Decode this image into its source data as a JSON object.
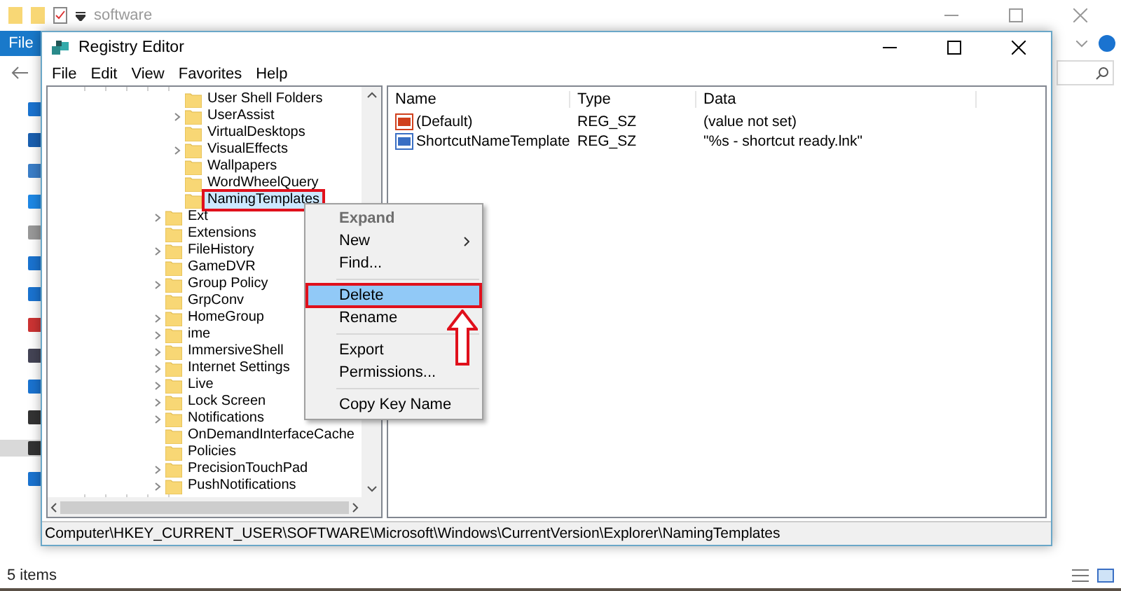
{
  "explorer": {
    "title": "software",
    "file_tab": "File",
    "status": "5 items"
  },
  "regedit": {
    "title": "Registry Editor",
    "menu": [
      "File",
      "Edit",
      "View",
      "Favorites",
      "Help"
    ],
    "tree": [
      {
        "children": [
          {
            "label": "User Shell Folders",
            "expandable": false,
            "selected": false,
            "annotated": false
          },
          {
            "label": "UserAssist",
            "expandable": true,
            "selected": false,
            "annotated": false
          },
          {
            "label": "VirtualDesktops",
            "expandable": false,
            "selected": false,
            "annotated": false
          },
          {
            "label": "VisualEffects",
            "expandable": true,
            "selected": false,
            "annotated": false
          },
          {
            "label": "Wallpapers",
            "expandable": false,
            "selected": false,
            "annotated": false
          },
          {
            "label": "WordWheelQuery",
            "expandable": false,
            "selected": false,
            "annotated": false
          },
          {
            "label": "NamingTemplates",
            "expandable": false,
            "selected": true,
            "annotated": true
          }
        ]
      },
      {
        "label": "Ext",
        "expandable": true,
        "selected": false,
        "annotated": false
      },
      {
        "label": "Extensions",
        "expandable": false,
        "selected": false,
        "annotated": false
      },
      {
        "label": "FileHistory",
        "expandable": true,
        "selected": false,
        "annotated": false
      },
      {
        "label": "GameDVR",
        "expandable": false,
        "selected": false,
        "annotated": false
      },
      {
        "label": "Group Policy",
        "expandable": true,
        "selected": false,
        "annotated": false
      },
      {
        "label": "GrpConv",
        "expandable": false,
        "selected": false,
        "annotated": false
      },
      {
        "label": "HomeGroup",
        "expandable": true,
        "selected": false,
        "annotated": false
      },
      {
        "label": "ime",
        "expandable": true,
        "selected": false,
        "annotated": false
      },
      {
        "label": "ImmersiveShell",
        "expandable": true,
        "selected": false,
        "annotated": false
      },
      {
        "label": "Internet Settings",
        "expandable": true,
        "selected": false,
        "annotated": false
      },
      {
        "label": "Live",
        "expandable": true,
        "selected": false,
        "annotated": false
      },
      {
        "label": "Lock Screen",
        "expandable": true,
        "selected": false,
        "annotated": false
      },
      {
        "label": "Notifications",
        "expandable": true,
        "selected": false,
        "annotated": false
      },
      {
        "label": "OnDemandInterfaceCache",
        "expandable": false,
        "selected": false,
        "annotated": false
      },
      {
        "label": "Policies",
        "expandable": false,
        "selected": false,
        "annotated": false
      },
      {
        "label": "PrecisionTouchPad",
        "expandable": true,
        "selected": false,
        "annotated": false
      },
      {
        "label": "PushNotifications",
        "expandable": true,
        "selected": false,
        "annotated": false
      }
    ],
    "columns": [
      "Name",
      "Type",
      "Data"
    ],
    "values": [
      {
        "name": "(Default)",
        "type": "REG_SZ",
        "data": "(value not set)",
        "color": "#d0401c"
      },
      {
        "name": "ShortcutNameTemplate",
        "type": "REG_SZ",
        "data": "\"%s - shortcut ready.lnk\"",
        "color": "#3a6fc4"
      }
    ],
    "path": "Computer\\HKEY_CURRENT_USER\\SOFTWARE\\Microsoft\\Windows\\CurrentVersion\\Explorer\\NamingTemplates"
  },
  "context_menu": [
    {
      "kind": "item",
      "label": "Expand",
      "disabled": true,
      "submenu": false,
      "selected": false,
      "annotated": false
    },
    {
      "kind": "item",
      "label": "New",
      "disabled": false,
      "submenu": true,
      "selected": false,
      "annotated": false
    },
    {
      "kind": "item",
      "label": "Find...",
      "disabled": false,
      "submenu": false,
      "selected": false,
      "annotated": false
    },
    {
      "kind": "separator"
    },
    {
      "kind": "item",
      "label": "Delete",
      "disabled": false,
      "submenu": false,
      "selected": true,
      "annotated": true
    },
    {
      "kind": "item",
      "label": "Rename",
      "disabled": false,
      "submenu": false,
      "selected": false,
      "annotated": false
    },
    {
      "kind": "separator"
    },
    {
      "kind": "item",
      "label": "Export",
      "disabled": false,
      "submenu": false,
      "selected": false,
      "annotated": false
    },
    {
      "kind": "item",
      "label": "Permissions...",
      "disabled": false,
      "submenu": false,
      "selected": false,
      "annotated": false
    },
    {
      "kind": "separator"
    },
    {
      "kind": "item",
      "label": "Copy Key Name",
      "disabled": false,
      "submenu": false,
      "selected": false,
      "annotated": false
    }
  ]
}
